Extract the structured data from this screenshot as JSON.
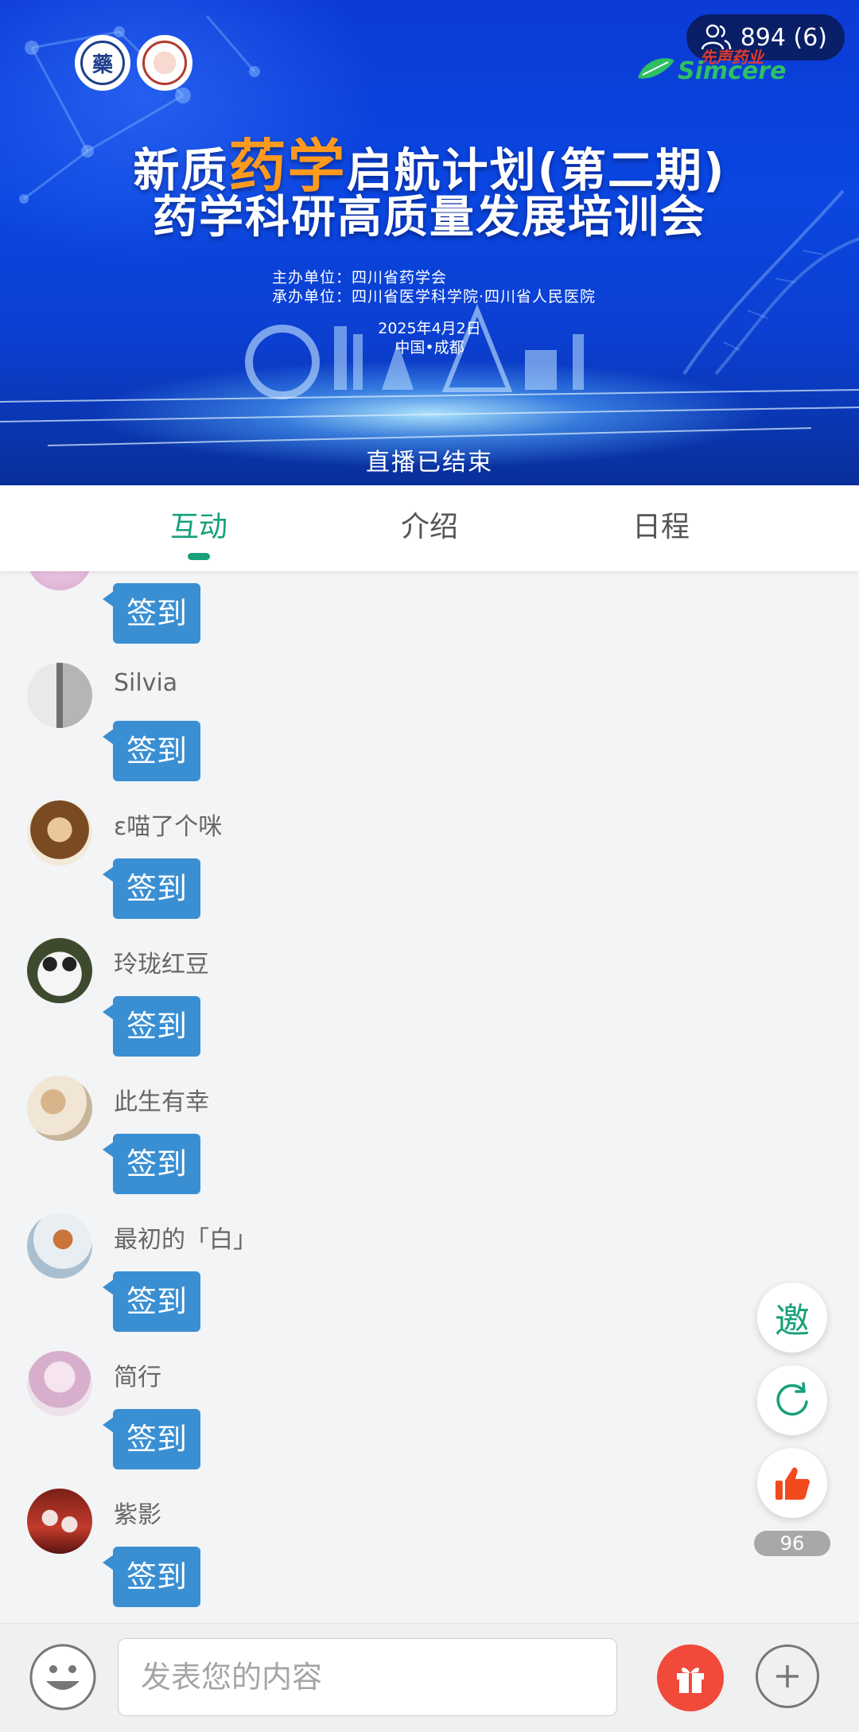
{
  "banner": {
    "viewers": "894 (6)",
    "sponsor_cn": "先声药业",
    "sponsor_en": "Simcere",
    "logo_a_text": "藥",
    "title_part1": "新质",
    "title_highlight": "药学",
    "title_part2": "启航计划(第二期)",
    "subtitle": "药学科研高质量发展培训会",
    "organizer": "主办单位：四川省药学会",
    "co_organizer": "承办单位：四川省医学科学院·四川省人民医院",
    "date": "2025年4月2日",
    "place": "中国•成都",
    "status": "直播已结束"
  },
  "tabs": {
    "interact": "互动",
    "intro": "介绍",
    "schedule": "日程",
    "active": "互动"
  },
  "chat": {
    "messages": [
      {
        "user": "",
        "text": "签到",
        "avatar_color": "#e8c8e8"
      },
      {
        "user": "Silvia",
        "text": "签到",
        "avatar_color": "#8d8d8d"
      },
      {
        "user": "ε喵了个咪",
        "text": "签到",
        "avatar_color": "#c49a4a"
      },
      {
        "user": "玲珑红豆",
        "text": "签到",
        "avatar_color": "#3c3c3c"
      },
      {
        "user": "此生有幸",
        "text": "签到",
        "avatar_color": "#b89a7a"
      },
      {
        "user": "最初的「白」",
        "text": "签到",
        "avatar_color": "#9fb6c8"
      },
      {
        "user": "简行",
        "text": "签到",
        "avatar_color": "#d9b8cf"
      },
      {
        "user": "紫影",
        "text": "签到",
        "avatar_color": "#b0302a"
      }
    ]
  },
  "floating": {
    "invite_label": "邀",
    "like_count": "96"
  },
  "bottom": {
    "input_placeholder": "发表您的内容"
  },
  "colors": {
    "accent": "#17a07a",
    "bubble": "#3a8fd3",
    "gift": "#f14a3a"
  }
}
